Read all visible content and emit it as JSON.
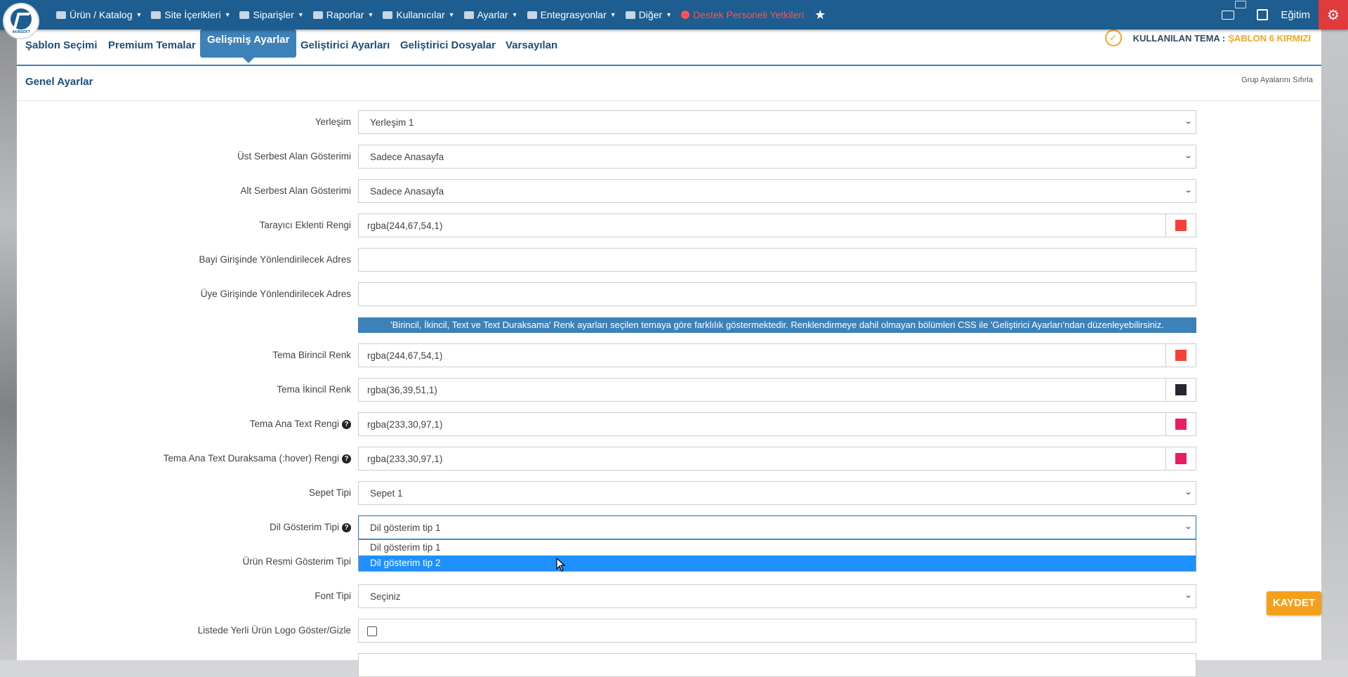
{
  "nav": {
    "items": [
      {
        "label": "Ürün / Katalog",
        "icon": "boxes-icon"
      },
      {
        "label": "Site İçerikleri",
        "icon": "files-icon"
      },
      {
        "label": "Siparişler",
        "icon": "truck-icon"
      },
      {
        "label": "Raporlar",
        "icon": "report-icon"
      },
      {
        "label": "Kullanıcılar",
        "icon": "users-icon"
      },
      {
        "label": "Ayarlar",
        "icon": "gears-icon"
      },
      {
        "label": "Entegrasyonlar",
        "icon": "network-icon"
      },
      {
        "label": "Diğer",
        "icon": "grid-icon"
      },
      {
        "label": "Destek Personeli Yetkileri",
        "icon": "user-circle-icon"
      }
    ],
    "egitim": "Eğitim"
  },
  "tabs": [
    {
      "label": "Şablon Seçimi"
    },
    {
      "label": "Premium Temalar"
    },
    {
      "label": "Gelişmiş Ayarlar"
    },
    {
      "label": "Geliştirici Ayarları"
    },
    {
      "label": "Geliştirici Dosyalar"
    },
    {
      "label": "Varsayılan"
    }
  ],
  "theme": {
    "label": "KULLANILAN TEMA :",
    "value": "ŞABLON 6 KIRMIZI"
  },
  "section": {
    "title": "Genel Ayarlar",
    "reset": "Grup Ayalarını Sıfırla"
  },
  "form": {
    "yerlesim": {
      "label": "Yerleşim",
      "value": "Yerleşim 1"
    },
    "ust_serbest": {
      "label": "Üst Serbest Alan Gösterimi",
      "value": "Sadece Anasayfa"
    },
    "alt_serbest": {
      "label": "Alt Serbest Alan Gösterimi",
      "value": "Sadece Anasayfa"
    },
    "tarayici": {
      "label": "Tarayıcı Eklenti Rengi",
      "value": "rgba(244,67,54,1)",
      "color": "#f44336"
    },
    "bayi": {
      "label": "Bayi Girişinde Yönlendirilecek Adres",
      "value": ""
    },
    "uye": {
      "label": "Üye Girişinde Yönlendirilecek Adres",
      "value": ""
    },
    "info": "'Birincil, İkincil, Text ve Text Duraksama' Renk ayarları seçilen temaya göre farklılık göstermektedir. Renklendirmeye dahil olmayan bölümleri CSS ile 'Geliştirici Ayarları'ndan düzenleyebilirsiniz.",
    "birincil": {
      "label": "Tema Birincil Renk",
      "value": "rgba(244,67,54,1)",
      "color": "#f44336"
    },
    "ikincil": {
      "label": "Tema İkincil Renk",
      "value": "rgba(36,39,51,1)",
      "color": "#242733"
    },
    "text": {
      "label": "Tema Ana Text Rengi",
      "value": "rgba(233,30,97,1)",
      "color": "#e91e61"
    },
    "hover": {
      "label": "Tema Ana Text Duraksama (:hover) Rengi",
      "value": "rgba(233,30,97,1)",
      "color": "#e91e61"
    },
    "sepet": {
      "label": "Sepet Tipi",
      "value": "Sepet 1"
    },
    "dil": {
      "label": "Dil Gösterim Tipi",
      "value": "Dil gösterim tip 1",
      "options": [
        "Dil gösterim tip 1",
        "Dil gösterim tip 2"
      ],
      "highlighted": "Dil gösterim tip 2"
    },
    "urun_resmi": {
      "label": "Ürün Resmi Gösterim Tipi"
    },
    "font": {
      "label": "Font Tipi",
      "value": "Seçiniz"
    },
    "logo": {
      "label": "Listede Yerli Ürün Logo Göster/Gizle",
      "checked": false
    }
  },
  "save_label": "KAYDET"
}
